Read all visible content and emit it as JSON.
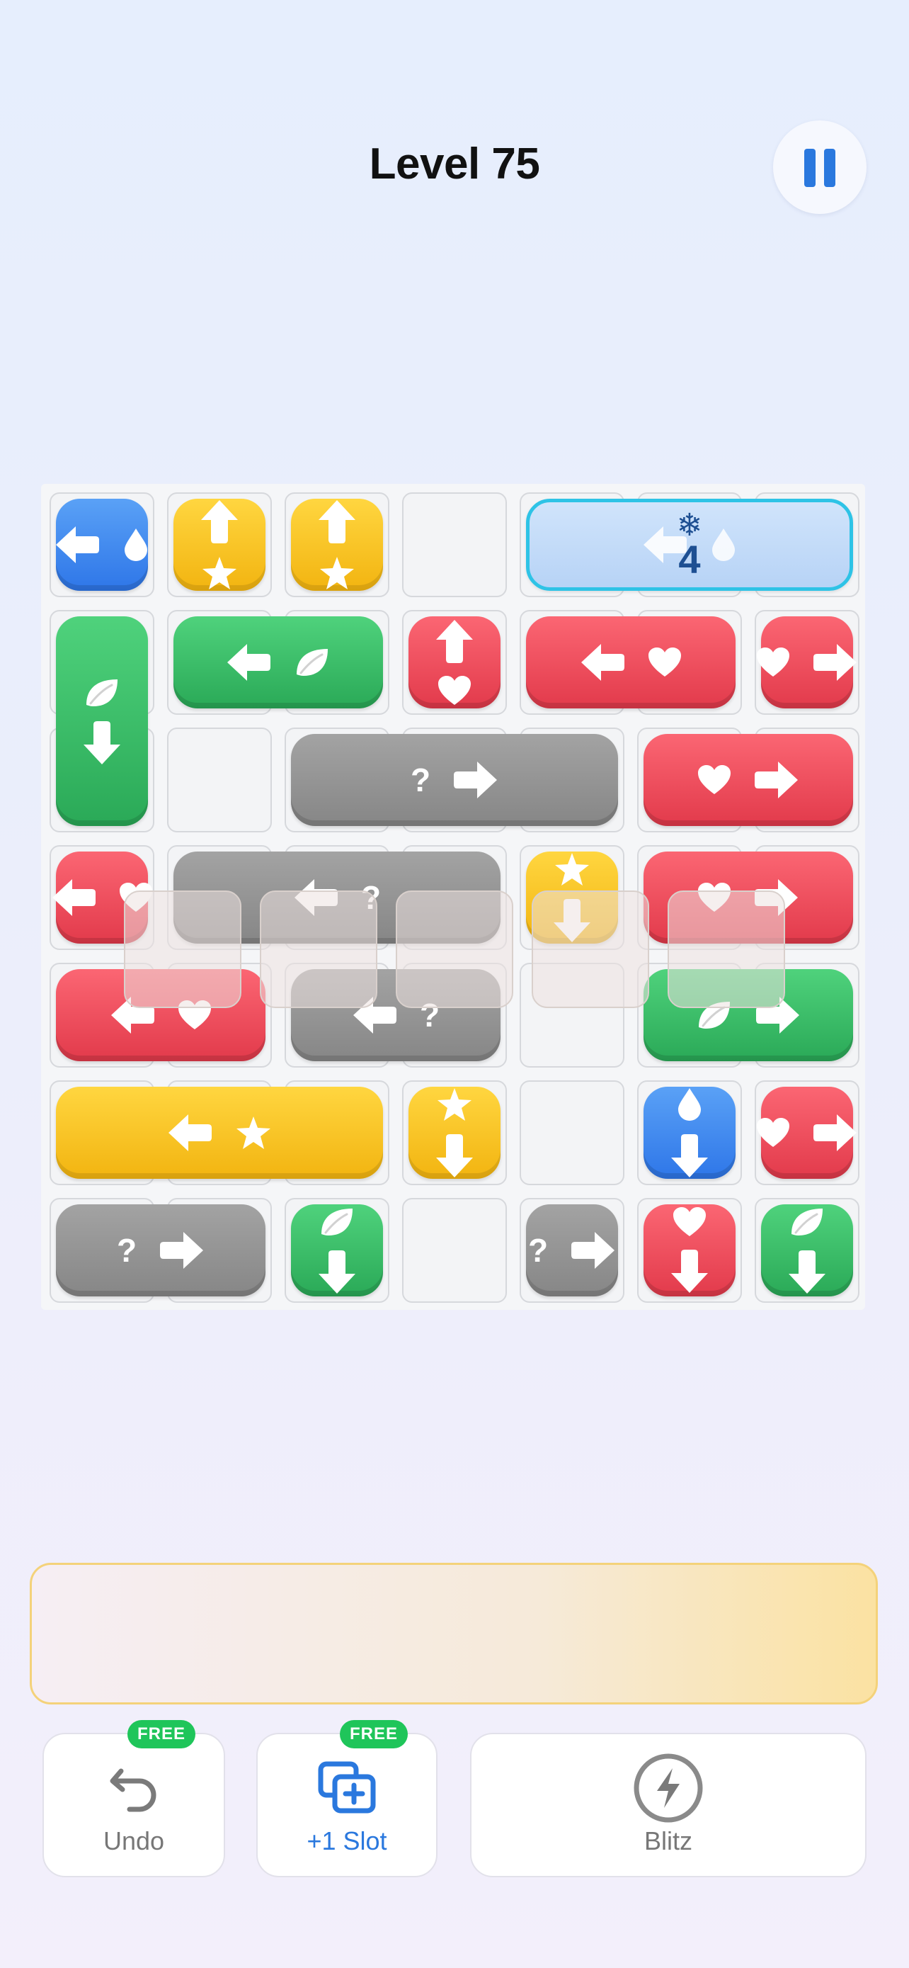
{
  "header": {
    "title": "Level 75",
    "pause_icon": "pause-icon"
  },
  "board": {
    "rows": 7,
    "cols": 7,
    "colors": {
      "blue": "#3b82f0",
      "yellow": "#f5c024",
      "green": "#37bb66",
      "red": "#ec4b5b",
      "gray": "#939393",
      "frozen_border": "#2ec3e6"
    },
    "blocks": [
      {
        "color": "blue",
        "row": 0,
        "col": 0,
        "w": 1,
        "h": 1,
        "dir": "left",
        "sym": "drop"
      },
      {
        "color": "yellow",
        "row": 0,
        "col": 1,
        "w": 1,
        "h": 1,
        "dir": "up",
        "sym": "star"
      },
      {
        "color": "yellow",
        "row": 0,
        "col": 2,
        "w": 1,
        "h": 1,
        "dir": "up",
        "sym": "star"
      },
      {
        "color": "frozen",
        "row": 0,
        "col": 4,
        "w": 3,
        "h": 1,
        "dir": "left",
        "sym": "drop",
        "frozen": true,
        "count": "4"
      },
      {
        "color": "green",
        "row": 1,
        "col": 0,
        "w": 1,
        "h": 2,
        "dir": "down",
        "sym": "leaf"
      },
      {
        "color": "green",
        "row": 1,
        "col": 1,
        "w": 2,
        "h": 1,
        "dir": "left",
        "sym": "leaf"
      },
      {
        "color": "red",
        "row": 1,
        "col": 3,
        "w": 1,
        "h": 1,
        "dir": "up",
        "sym": "heart"
      },
      {
        "color": "red",
        "row": 1,
        "col": 4,
        "w": 2,
        "h": 1,
        "dir": "left",
        "sym": "heart"
      },
      {
        "color": "red",
        "row": 1,
        "col": 6,
        "w": 1,
        "h": 1,
        "dir": "right",
        "sym": "heart"
      },
      {
        "color": "gray",
        "row": 2,
        "col": 2,
        "w": 3,
        "h": 1,
        "dir": "right",
        "sym": "?"
      },
      {
        "color": "red",
        "row": 2,
        "col": 5,
        "w": 2,
        "h": 1,
        "dir": "right",
        "sym": "heart"
      },
      {
        "color": "red",
        "row": 3,
        "col": 0,
        "w": 1,
        "h": 1,
        "dir": "left",
        "sym": "heart"
      },
      {
        "color": "gray",
        "row": 3,
        "col": 1,
        "w": 3,
        "h": 1,
        "dir": "left",
        "sym": "?"
      },
      {
        "color": "yellow",
        "row": 3,
        "col": 4,
        "w": 1,
        "h": 1,
        "dir": "down",
        "sym": "star"
      },
      {
        "color": "red",
        "row": 3,
        "col": 5,
        "w": 2,
        "h": 1,
        "dir": "right",
        "sym": "heart"
      },
      {
        "color": "red",
        "row": 4,
        "col": 0,
        "w": 2,
        "h": 1,
        "dir": "left",
        "sym": "heart"
      },
      {
        "color": "gray",
        "row": 4,
        "col": 2,
        "w": 2,
        "h": 1,
        "dir": "left",
        "sym": "?"
      },
      {
        "color": "green",
        "row": 4,
        "col": 5,
        "w": 2,
        "h": 1,
        "dir": "right",
        "sym": "leaf"
      },
      {
        "color": "yellow",
        "row": 5,
        "col": 0,
        "w": 3,
        "h": 1,
        "dir": "left",
        "sym": "star"
      },
      {
        "color": "yellow",
        "row": 5,
        "col": 3,
        "w": 1,
        "h": 1,
        "dir": "down",
        "sym": "star"
      },
      {
        "color": "blue",
        "row": 5,
        "col": 5,
        "w": 1,
        "h": 1,
        "dir": "down",
        "sym": "drop"
      },
      {
        "color": "red",
        "row": 5,
        "col": 6,
        "w": 1,
        "h": 1,
        "dir": "right",
        "sym": "heart"
      },
      {
        "color": "gray",
        "row": 6,
        "col": 0,
        "w": 2,
        "h": 1,
        "dir": "right",
        "sym": "?"
      },
      {
        "color": "green",
        "row": 6,
        "col": 2,
        "w": 1,
        "h": 1,
        "dir": "down",
        "sym": "leaf"
      },
      {
        "color": "gray",
        "row": 6,
        "col": 4,
        "w": 1,
        "h": 1,
        "dir": "right",
        "sym": "?"
      },
      {
        "color": "red",
        "row": 6,
        "col": 5,
        "w": 1,
        "h": 1,
        "dir": "down",
        "sym": "heart"
      },
      {
        "color": "green",
        "row": 6,
        "col": 6,
        "w": 1,
        "h": 1,
        "dir": "down",
        "sym": "leaf"
      }
    ]
  },
  "tray": {
    "slots": 5
  },
  "powerups": {
    "undo": {
      "label": "Undo",
      "badge": "FREE",
      "icon": "undo-icon",
      "color": "#777777"
    },
    "slot": {
      "label": "+1 Slot",
      "badge": "FREE",
      "icon": "add-slot-icon",
      "color": "#2a78de"
    },
    "blitz": {
      "label": "Blitz",
      "icon": "lightning-icon",
      "color": "#777777"
    }
  }
}
